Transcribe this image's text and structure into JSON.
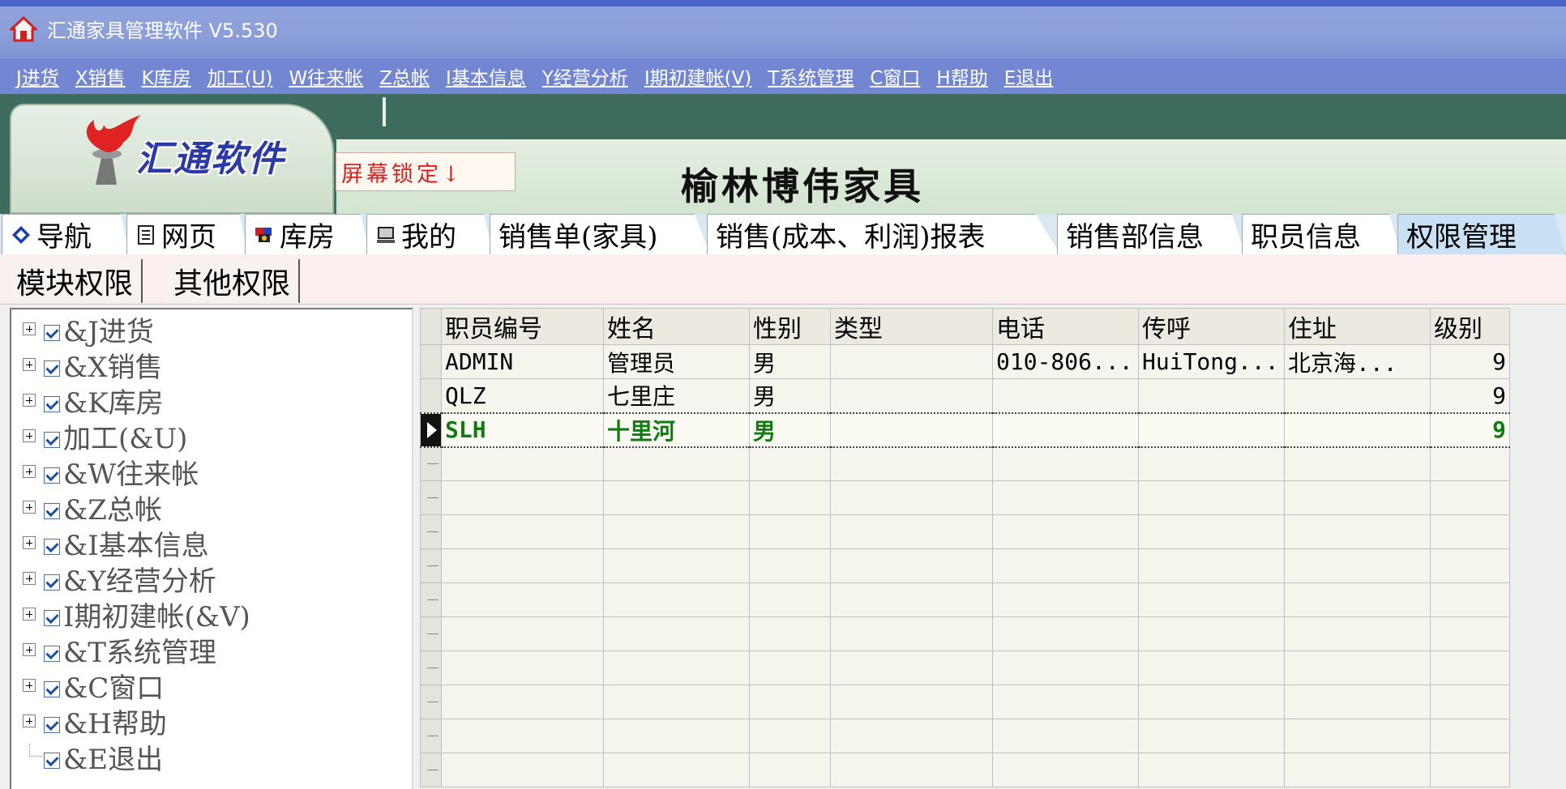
{
  "window": {
    "title": "汇通家具管理软件 V5.530"
  },
  "menu": [
    "J进货",
    "X销售",
    "K库房",
    "加工(U)",
    "W往来帐",
    "Z总帐",
    "I基本信息",
    "Y经营分析",
    "I期初建帐(V)",
    "T系统管理",
    "C窗口",
    "H帮助",
    "E退出"
  ],
  "banner": {
    "logo_text": "汇通软件",
    "lock_button": "屏幕锁定↓",
    "company_name": "榆林博伟家具"
  },
  "tabs": [
    {
      "label": "导航",
      "icon": "navigation-icon"
    },
    {
      "label": "网页",
      "icon": "webpage-icon"
    },
    {
      "label": "库房",
      "icon": "warehouse-icon"
    },
    {
      "label": "我的",
      "icon": "my-computer-icon"
    },
    {
      "label": "销售单(家具)"
    },
    {
      "label": "销售(成本、利润)报表"
    },
    {
      "label": "销售部信息"
    },
    {
      "label": "职员信息"
    },
    {
      "label": "权限管理",
      "active": true
    }
  ],
  "subtabs": [
    "模块权限",
    "其他权限"
  ],
  "tree": [
    {
      "label": "&J进货",
      "checked": true
    },
    {
      "label": "&X销售",
      "checked": true
    },
    {
      "label": "&K库房",
      "checked": true
    },
    {
      "label": "加工(&U)",
      "checked": true
    },
    {
      "label": "&W往来帐",
      "checked": true
    },
    {
      "label": "&Z总帐",
      "checked": true
    },
    {
      "label": "&I基本信息",
      "checked": true
    },
    {
      "label": "&Y经营分析",
      "checked": true
    },
    {
      "label": "I期初建帐(&V)",
      "checked": true
    },
    {
      "label": "&T系统管理",
      "checked": true
    },
    {
      "label": "&C窗口",
      "checked": true
    },
    {
      "label": "&H帮助",
      "checked": true
    },
    {
      "label": "&E退出",
      "checked": true
    }
  ],
  "grid": {
    "columns": [
      "职员编号",
      "姓名",
      "性别",
      "类型",
      "电话",
      "传呼",
      "住址",
      "级别"
    ],
    "rows": [
      [
        "ADMIN",
        "管理员",
        "男",
        "",
        "010-806...",
        "HuiTong...",
        "北京海...",
        "9"
      ],
      [
        "QLZ",
        "七里庄",
        "男",
        "",
        "",
        "",
        "",
        "9"
      ],
      [
        "SLH",
        "十里河",
        "男",
        "",
        "",
        "",
        "",
        "9"
      ]
    ],
    "current_row": 2,
    "current_color": "#127a12"
  }
}
